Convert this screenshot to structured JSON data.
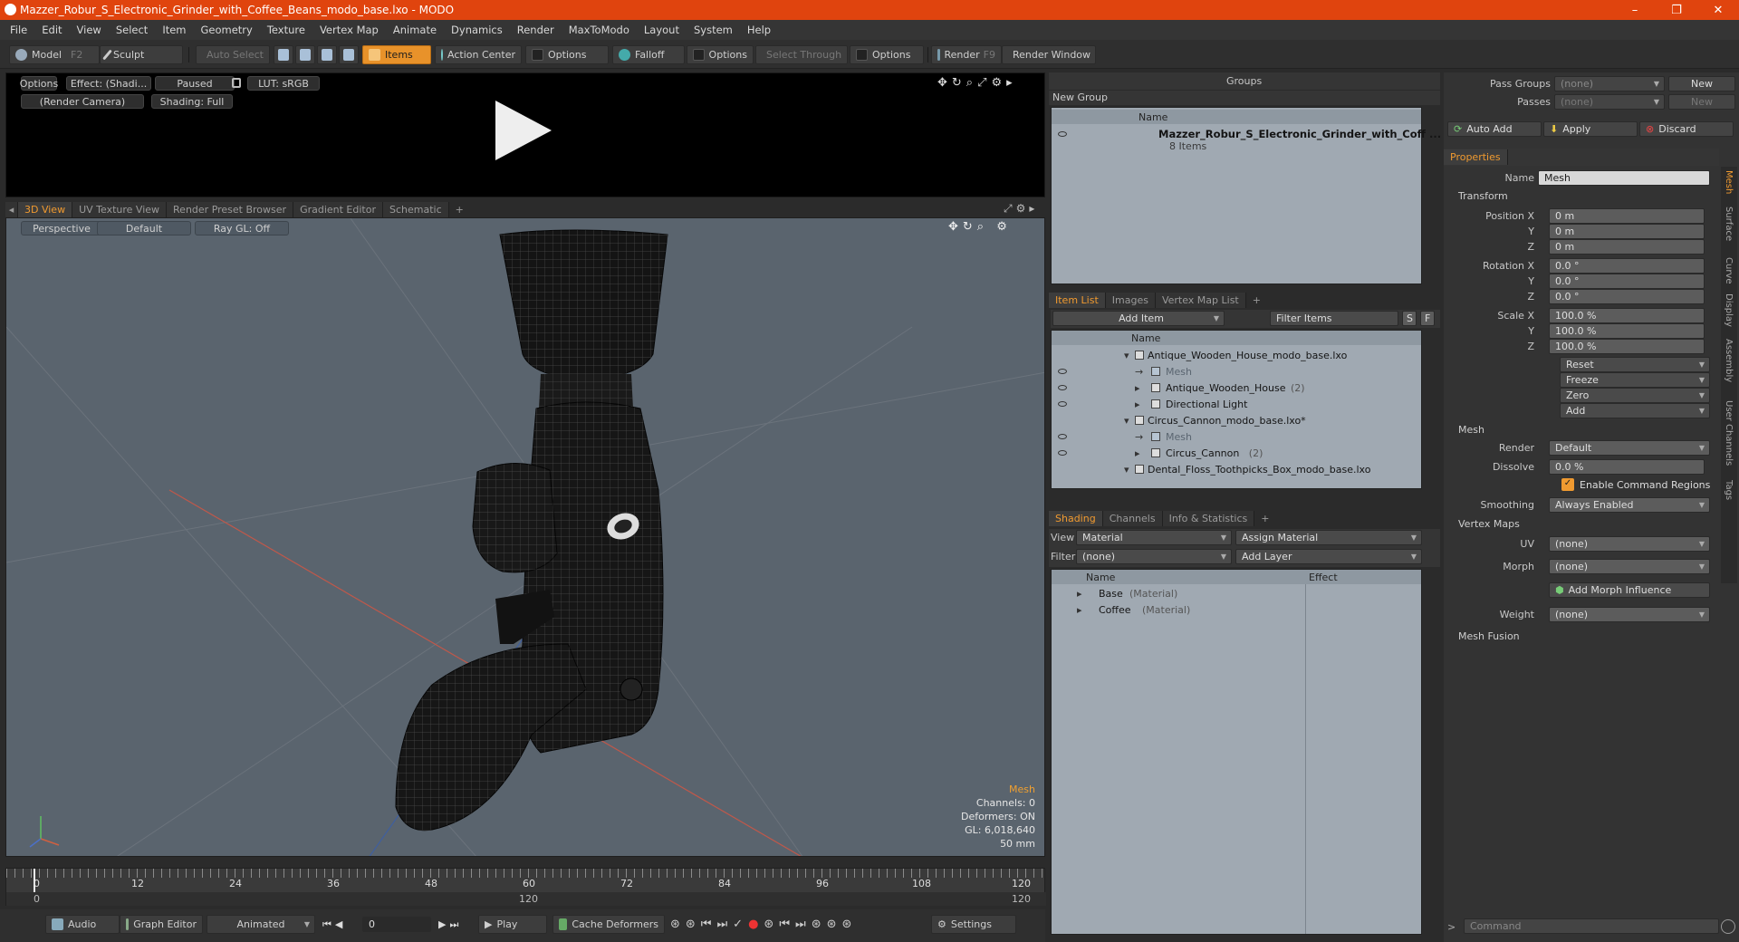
{
  "window": {
    "title": "Mazzer_Robur_S_Electronic_Grinder_with_Coffee_Beans_modo_base.lxo - MODO",
    "minimize": "–",
    "maximize": "❐",
    "close": "✕"
  },
  "menu": [
    "File",
    "Edit",
    "View",
    "Select",
    "Item",
    "Geometry",
    "Texture",
    "Vertex Map",
    "Animate",
    "Dynamics",
    "Render",
    "MaxToModo",
    "Layout",
    "System",
    "Help"
  ],
  "toolbar": {
    "model": "Model",
    "model_key": "F2",
    "sculpt": "Sculpt",
    "auto_select": "Auto Select",
    "items": "Items",
    "action_center": "Action Center",
    "options1": "Options",
    "falloff": "Falloff",
    "options2": "Options",
    "select_through": "Select Through",
    "options3": "Options",
    "render": "Render",
    "render_key": "F9",
    "render_window": "Render Window"
  },
  "preview": {
    "options": "Options",
    "effect": "Effect: (Shadi...",
    "paused": "Paused",
    "lut": "LUT: sRGB",
    "camera": "(Render Camera)",
    "shading": "Shading: Full"
  },
  "viewport_tabs": [
    "3D View",
    "UV Texture View",
    "Render Preset Browser",
    "Gradient Editor",
    "Schematic",
    "+"
  ],
  "viewport": {
    "perspective": "Perspective",
    "default": "Default",
    "raygl": "Ray GL: Off",
    "stats": {
      "mesh": "Mesh",
      "channels": "Channels: 0",
      "deformers": "Deformers: ON",
      "gl": "GL: 6,018,640",
      "size": "50 mm"
    }
  },
  "timeline": {
    "ticks": [
      "0",
      "12",
      "24",
      "36",
      "48",
      "60",
      "72",
      "84",
      "96",
      "108",
      "120"
    ],
    "sub": [
      "0",
      "120",
      "120"
    ],
    "current": "0"
  },
  "bottombar": {
    "audio": "Audio",
    "graph_editor": "Graph Editor",
    "animated": "Animated",
    "frame": "0",
    "play": "Play",
    "cache": "Cache Deformers",
    "settings": "Settings"
  },
  "groups": {
    "title": "Groups",
    "new_group": "New Group",
    "col_name": "Name",
    "item_name": "Mazzer_Robur_S_Electronic_Grinder_with_Coff ...",
    "item_count": "8 Items"
  },
  "item_list": {
    "tabs": [
      "Item List",
      "Images",
      "Vertex Map List",
      "+"
    ],
    "add_item": "Add Item",
    "filter": "Filter Items",
    "s": "S",
    "f": "F",
    "col_name": "Name",
    "rows": [
      {
        "label": "Antique_Wooden_House_modo_base.lxo",
        "suffix": "",
        "indent": 0,
        "dim": false
      },
      {
        "label": "Mesh",
        "suffix": "",
        "indent": 2,
        "dim": true
      },
      {
        "label": "Antique_Wooden_House",
        "suffix": "(2)",
        "indent": 1,
        "dim": false
      },
      {
        "label": "Directional Light",
        "suffix": "",
        "indent": 1,
        "dim": false
      },
      {
        "label": "Circus_Cannon_modo_base.lxo*",
        "suffix": "",
        "indent": 0,
        "dim": false
      },
      {
        "label": "Mesh",
        "suffix": "",
        "indent": 2,
        "dim": true
      },
      {
        "label": "Circus_Cannon",
        "suffix": "(2)",
        "indent": 1,
        "dim": false
      },
      {
        "label": "Dental_Floss_Toothpicks_Box_modo_base.lxo",
        "suffix": "",
        "indent": 0,
        "dim": false
      }
    ]
  },
  "shading": {
    "tabs": [
      "Shading",
      "Channels",
      "Info & Statistics",
      "+"
    ],
    "view_label": "View",
    "view_value": "Material",
    "assign": "Assign Material",
    "filter_label": "Filter",
    "filter_value": "(none)",
    "add_layer": "Add Layer",
    "col_name": "Name",
    "col_effect": "Effect",
    "rows": [
      {
        "label": "Base",
        "type": "(Material)"
      },
      {
        "label": "Coffee",
        "type": "(Material)"
      }
    ]
  },
  "right": {
    "pass_groups": "Pass Groups",
    "passes": "Passes",
    "none": "(none)",
    "new": "New",
    "auto_add": "Auto Add",
    "apply": "Apply",
    "discard": "Discard",
    "properties": "Properties",
    "name_label": "Name",
    "name_value": "Mesh",
    "transform": "Transform",
    "pos_x": "Position X",
    "y": "Y",
    "z": "Z",
    "rot_x": "Rotation X",
    "scale_x": "Scale X",
    "m0": "0 m",
    "deg0": "0.0 °",
    "pct100": "100.0 %",
    "reset": "Reset",
    "freeze": "Freeze",
    "zero": "Zero",
    "add": "Add",
    "mesh": "Mesh",
    "render": "Render",
    "render_value": "Default",
    "dissolve": "Dissolve",
    "dissolve_value": "0.0 %",
    "enable_cmd": "Enable Command Regions",
    "smoothing": "Smoothing",
    "smoothing_value": "Always Enabled",
    "vertex_maps": "Vertex Maps",
    "uv": "UV",
    "morph": "Morph",
    "add_morph": "Add Morph Influence",
    "weight": "Weight",
    "mesh_fusion": "Mesh Fusion",
    "command": "Command",
    "vtabs": [
      "Mesh",
      "Surface",
      "Curve",
      "Display",
      "Assembly",
      "User Channels",
      "Tags"
    ]
  }
}
